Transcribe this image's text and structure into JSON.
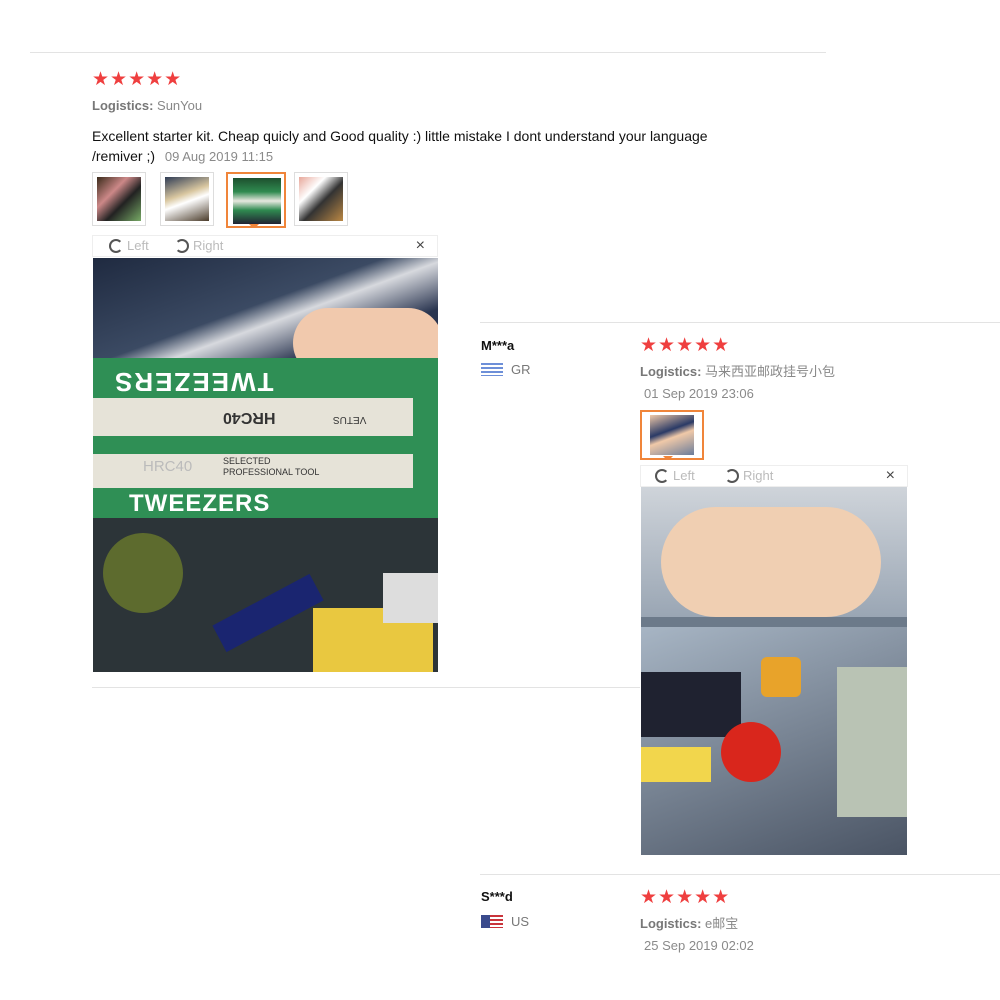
{
  "review1": {
    "stars": "★★★★★",
    "logistics_label": "Logistics:",
    "logistics_value": "SunYou",
    "text_line1": "Excellent starter kit. Cheap quicly and Good quality :) little mistake I dont understand your language",
    "text_line2": "/remiver ;)",
    "date": "09 Aug 2019 11:15",
    "viewer": {
      "left": "Left",
      "right": "Right",
      "close": "×"
    },
    "photo_labels": {
      "tweezers_top": "TWEEZERS",
      "hrc_top": "HRC40",
      "vetus": "VETUS",
      "selected_top": "SELECTED PROFESSIONAL TOOL",
      "hrc_bottom": "HRC40",
      "selected_bottom": "SELECTED PROFESSIONAL TOOL",
      "tweezers_bottom": "TWEEZERS"
    }
  },
  "review2": {
    "name": "M***a",
    "country": "GR",
    "stars": "★★★★★",
    "logistics_label": "Logistics:",
    "logistics_value": "马来西亚邮政挂号小包",
    "date": "01 Sep 2019 23:06",
    "viewer": {
      "left": "Left",
      "right": "Right",
      "close": "×"
    }
  },
  "review3": {
    "name": "S***d",
    "country": "US",
    "stars": "★★★★★",
    "logistics_label": "Logistics:",
    "logistics_value": "e邮宝",
    "date": "25 Sep 2019 02:02"
  },
  "colors": {
    "star": "#ef3f3f",
    "active_thumb": "#f0853a",
    "divider": "#e3e3e3"
  }
}
